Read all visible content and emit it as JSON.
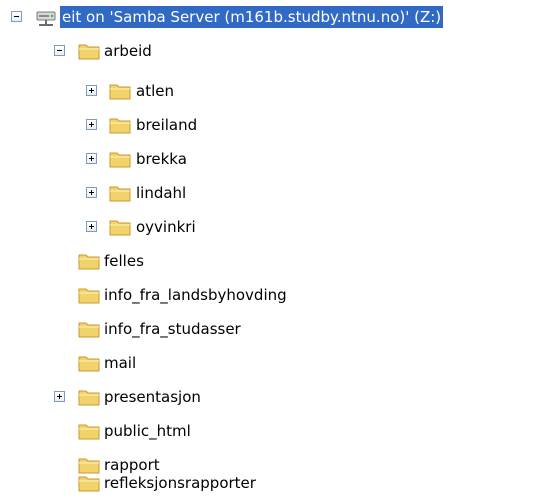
{
  "tree": {
    "root": {
      "label": "eit on 'Samba Server (m161b.studby.ntnu.no)' (Z:)",
      "icon": "network-drive-icon",
      "expanded": true,
      "selected": true
    },
    "items": [
      {
        "label": "arbeid",
        "icon": "folder-icon",
        "expanded": true,
        "level": 1
      },
      {
        "label": "atlen",
        "icon": "folder-icon",
        "expanded": false,
        "level": 2
      },
      {
        "label": "breiland",
        "icon": "folder-icon",
        "expanded": false,
        "level": 2
      },
      {
        "label": "brekka",
        "icon": "folder-icon",
        "expanded": false,
        "level": 2
      },
      {
        "label": "lindahl",
        "icon": "folder-icon",
        "expanded": false,
        "level": 2
      },
      {
        "label": "oyvinkri",
        "icon": "folder-icon",
        "expanded": false,
        "level": 2
      },
      {
        "label": "felles",
        "icon": "folder-icon",
        "level": 1
      },
      {
        "label": "info_fra_landsbyhovding",
        "icon": "folder-icon",
        "level": 1
      },
      {
        "label": "info_fra_studasser",
        "icon": "folder-icon",
        "level": 1
      },
      {
        "label": "mail",
        "icon": "folder-icon",
        "level": 1
      },
      {
        "label": "presentasjon",
        "icon": "folder-icon",
        "expanded": false,
        "level": 1
      },
      {
        "label": "public_html",
        "icon": "folder-icon",
        "level": 1
      },
      {
        "label": "rapport",
        "icon": "folder-icon",
        "level": 1
      },
      {
        "label": "refleksjonsrapporter",
        "icon": "folder-icon",
        "level": 1
      }
    ]
  },
  "colors": {
    "selection": "#316ac5",
    "folder": "#f2d36b",
    "folder_edge": "#c99a2e"
  }
}
